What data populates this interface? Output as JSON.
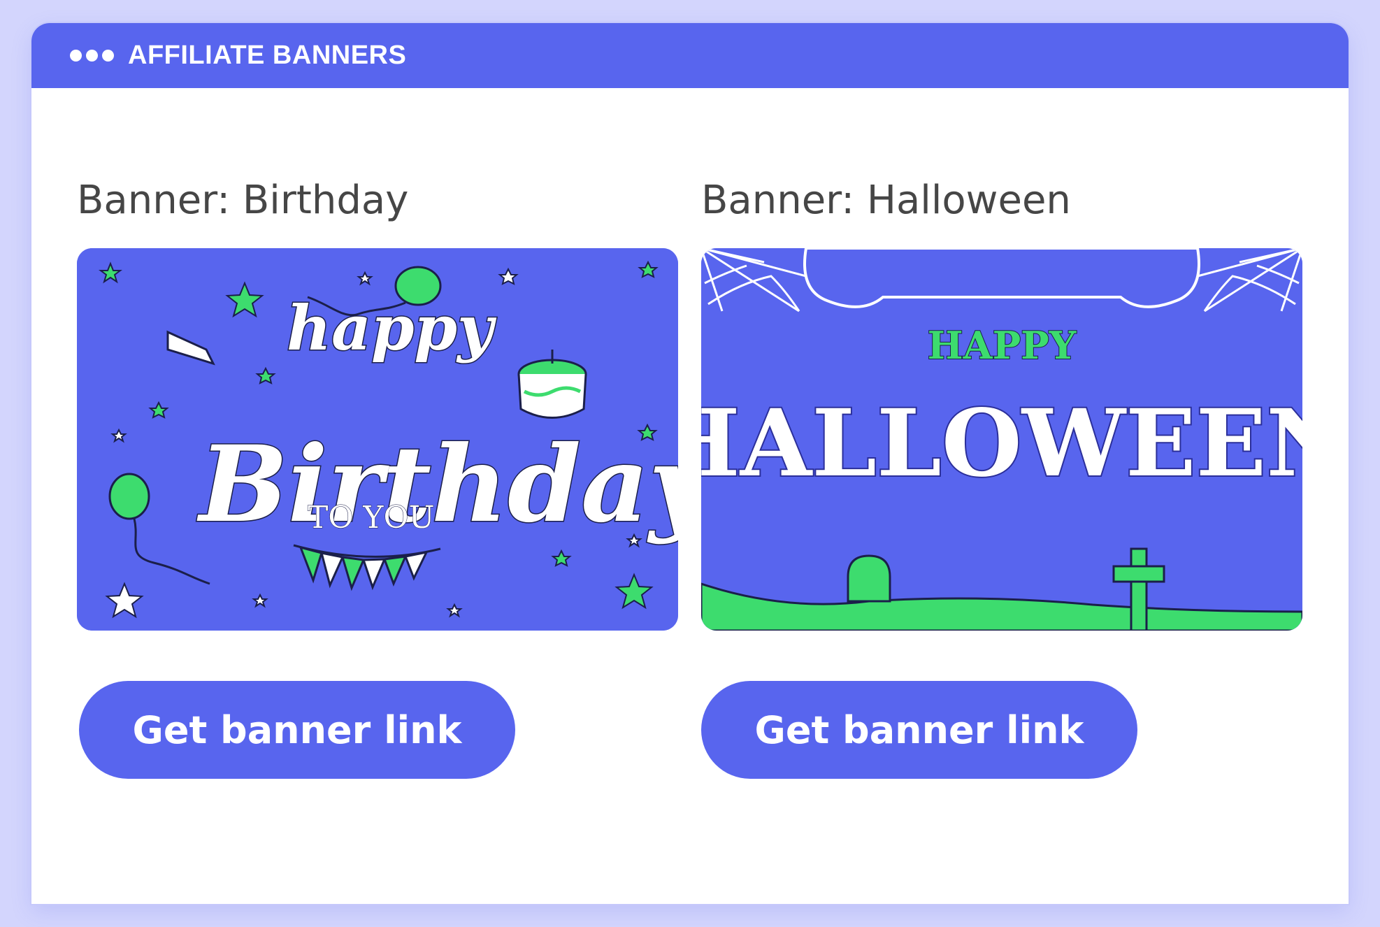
{
  "window": {
    "title": "AFFILIATE BANNERS",
    "header_color": "#5865ee"
  },
  "banners": [
    {
      "label": "Banner: Birthday",
      "art_line1": "happy",
      "art_line2": "Birthday",
      "art_line3": "TO YOU",
      "button_label": "Get banner link"
    },
    {
      "label": "Banner: Halloween",
      "art_line1": "HAPPY",
      "art_line2": "HALLOWEEN",
      "button_label": "Get banner link"
    }
  ],
  "colors": {
    "accent": "#5865ee",
    "green": "#3ddc6e",
    "background": "#d3d5fd"
  }
}
